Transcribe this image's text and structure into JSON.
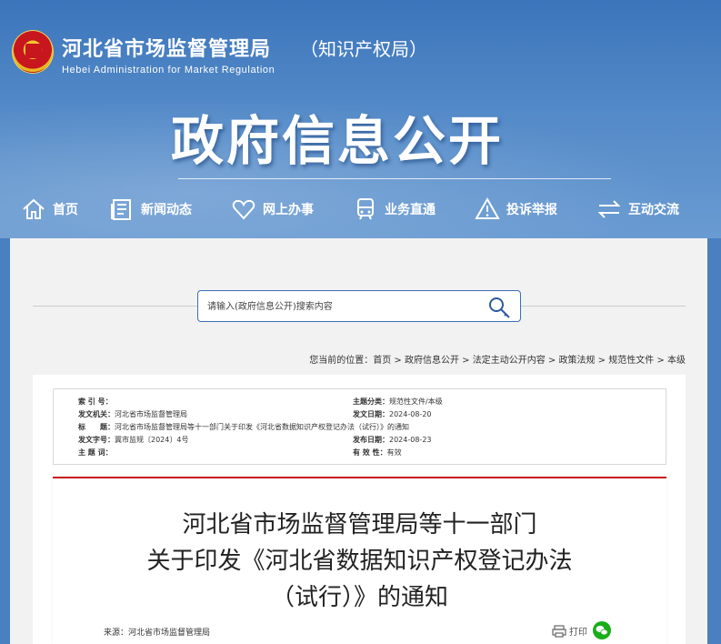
{
  "header": {
    "org_title": "河北省市场监督管理局",
    "org_sub": "（知识产权局）",
    "org_en": "Hebei Administration for Market Regulation",
    "big_title": "政府信息公开"
  },
  "nav": [
    {
      "label": "首页",
      "icon": "home-icon"
    },
    {
      "label": "新闻动态",
      "icon": "news-icon"
    },
    {
      "label": "网上办事",
      "icon": "heart-icon"
    },
    {
      "label": "业务直通",
      "icon": "train-icon"
    },
    {
      "label": "投诉举报",
      "icon": "warning-icon"
    },
    {
      "label": "互动交流",
      "icon": "exchange-icon"
    }
  ],
  "search": {
    "placeholder": "请输入(政府信息公开)搜索内容"
  },
  "breadcrumb": {
    "prefix": "您当前的位置：",
    "items": [
      "首页",
      "政府信息公开",
      "法定主动公开内容",
      "政策法规",
      "规范性文件",
      "本级"
    ],
    "sep": " > "
  },
  "meta": {
    "index_key": "索 引 号：",
    "index_val": "",
    "issuer_key": "发文机关：",
    "issuer_val": "河北省市场监督管理局",
    "title_key": "标　　题：",
    "title_val": "河北省市场监督管理局等十一部门关于印发《河北省数据知识产权登记办法（试行）》的通知",
    "docno_key": "发文字号：",
    "docno_val": "冀市监规〔2024〕4号",
    "theme_key": "主 题 词：",
    "theme_val": "",
    "category_key": "主题分类：",
    "category_val": "规范性文件/本级",
    "date_key": "发文日期：",
    "date_val": "2024-08-20",
    "pub_key": "发布日期：",
    "pub_val": "2024-08-23",
    "valid_key": "有 效 性：",
    "valid_val": "有效"
  },
  "doc": {
    "title_line1": "河北省市场监督管理局等十一部门",
    "title_line2": "关于印发《河北省数据知识产权登记办法",
    "title_line3": "（试行）》的通知",
    "source": "来源：河北省市场监督管理局",
    "print_label": "打印"
  },
  "colors": {
    "header_blue": "#3c75bb",
    "accent_red": "#c8161e",
    "search_border": "#3c6eb4",
    "wechat_green": "#1aad19"
  }
}
